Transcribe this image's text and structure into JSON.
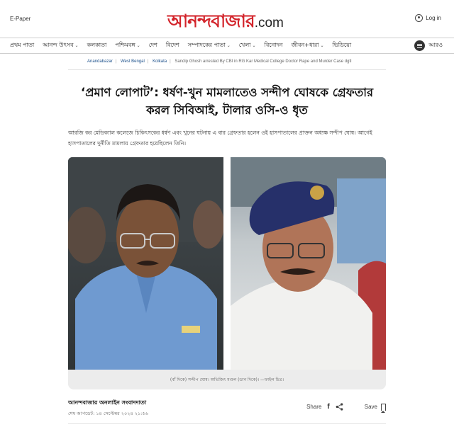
{
  "header": {
    "epaper": "E-Paper",
    "logo_bengali": "আনন্দবাজার",
    "logo_com": ".com",
    "login": "Log in"
  },
  "nav": {
    "items": [
      {
        "label": "প্রথম পাতা",
        "dropdown": false
      },
      {
        "label": "আনন্দ উৎসব",
        "dropdown": true
      },
      {
        "label": "কলকাতা",
        "dropdown": false
      },
      {
        "label": "পশ্চিমবঙ্গ",
        "dropdown": true
      },
      {
        "label": "দেশ",
        "dropdown": false
      },
      {
        "label": "বিদেশ",
        "dropdown": false
      },
      {
        "label": "সম্পাদকের পাতা",
        "dropdown": true
      },
      {
        "label": "খেলা",
        "dropdown": true
      },
      {
        "label": "বিনোদন",
        "dropdown": false
      },
      {
        "label": "জীবন+ধারা",
        "dropdown": true
      },
      {
        "label": "ভিডিয়ো",
        "dropdown": false
      }
    ],
    "more": "আরও"
  },
  "breadcrumb": [
    "Anandabazar",
    "West Bengal",
    "Kolkata",
    "Sandip Ghosh arrested By CBI in RG Kar Medical College Doctor Rape and Murder Case dgtl"
  ],
  "article": {
    "headline": "‘প্রমাণ লোপাট’: ধর্ষণ-খুন মামলাতেও সন্দীপ ঘোষকে গ্রেফতার করল সিবিআই, টালার ওসি-ও ধৃত",
    "subhead": "আরজি কর মেডিক্যাল কলেজে চিকিৎসকের ধর্ষণ এবং খুনের ঘটনায় এ বার গ্রেফতার হলেন ওই হাসপাতালের প্রাক্তন অধ্যক্ষ সন্দীপ ঘোষ। আগেই হাসপাতালের দুর্নীতি মামলায় গ্রেফতার হয়েছিলেন তিনি।",
    "caption": "(বাঁ দিকে) সন্দীপ ঘোষ। অভিজিৎ মণ্ডল (ডান দিকে)। —ফাইল চিত্র।",
    "author": "আনন্দবাজার অনলাইন সংবাদদাতা",
    "updated": "শেষ আপডেট: ১৪ সেপ্টেম্বর ২০২৪ ২১:৫৬",
    "share_label": "Share",
    "save_label": "Save"
  },
  "colors": {
    "brand": "#d3242b",
    "link": "#1a4f8a"
  }
}
